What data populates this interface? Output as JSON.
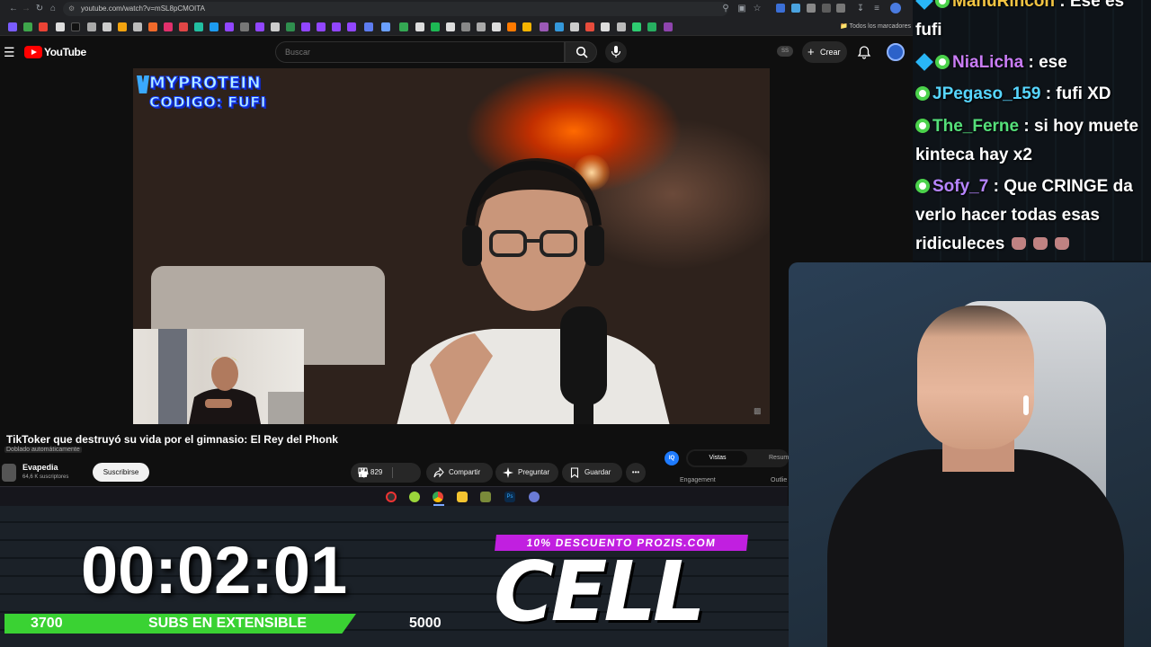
{
  "browser": {
    "url": "youtube.com/watch?v=mSL8pCMOITA",
    "all_bookmarks": "Todos los marcadores"
  },
  "youtube": {
    "logo_text": "YouTube",
    "search_placeholder": "Buscar",
    "create_label": "Crear",
    "ss_badge": "SS"
  },
  "video": {
    "promo_line1": "MYPROTEIN",
    "promo_line2": "CODIGO: FUFI",
    "title": "TikToker que destruyó su vida por el gimnasio: El Rey del Phonk",
    "dubbed_label": "Doblado automáticamente",
    "channel_name": "Evapedia",
    "channel_subs": "64,6 K suscriptores",
    "subscribe_label": "Suscribirse",
    "likes": "829",
    "share_label": "Compartir",
    "ask_label": "Preguntar",
    "save_label": "Guardar"
  },
  "side_panel": {
    "tab_active": "Vistas",
    "tab_other": "Resum",
    "engagement_label": "Engagement",
    "outlier_label": "Outlie",
    "iq_label": "IQ"
  },
  "chat": {
    "messages": [
      {
        "user": "ManuRincon",
        "text": ": Ese es fufi",
        "user_color": "#f4c542"
      },
      {
        "user": "NiaLicha",
        "text": ": ese",
        "user_color": "#c97cf5"
      },
      {
        "user": "JPegaso_159",
        "text": ": fufi XD",
        "user_color": "#57d6ff"
      },
      {
        "user": "The_Ferne",
        "text": ": si hoy muete kinteca hay x2",
        "user_color": "#55e07a"
      },
      {
        "user": "Sofy_7",
        "text": ": Que CRINGE da verlo hacer todas esas ridiculeces",
        "user_color": "#b785ff"
      }
    ]
  },
  "overlay": {
    "timer": "00:02:01",
    "subs_start": "3700",
    "subs_label": "SUBS EN EXTENSIBLE",
    "subs_goal": "5000",
    "progress_fraction": 0.79,
    "discount": "10% DESCUENTO PROZIS.COM",
    "code": "CELL"
  },
  "colors": {
    "yt_red": "#ff0000",
    "progress_green": "#3ad233",
    "promo_purple": "#c11fe0"
  }
}
